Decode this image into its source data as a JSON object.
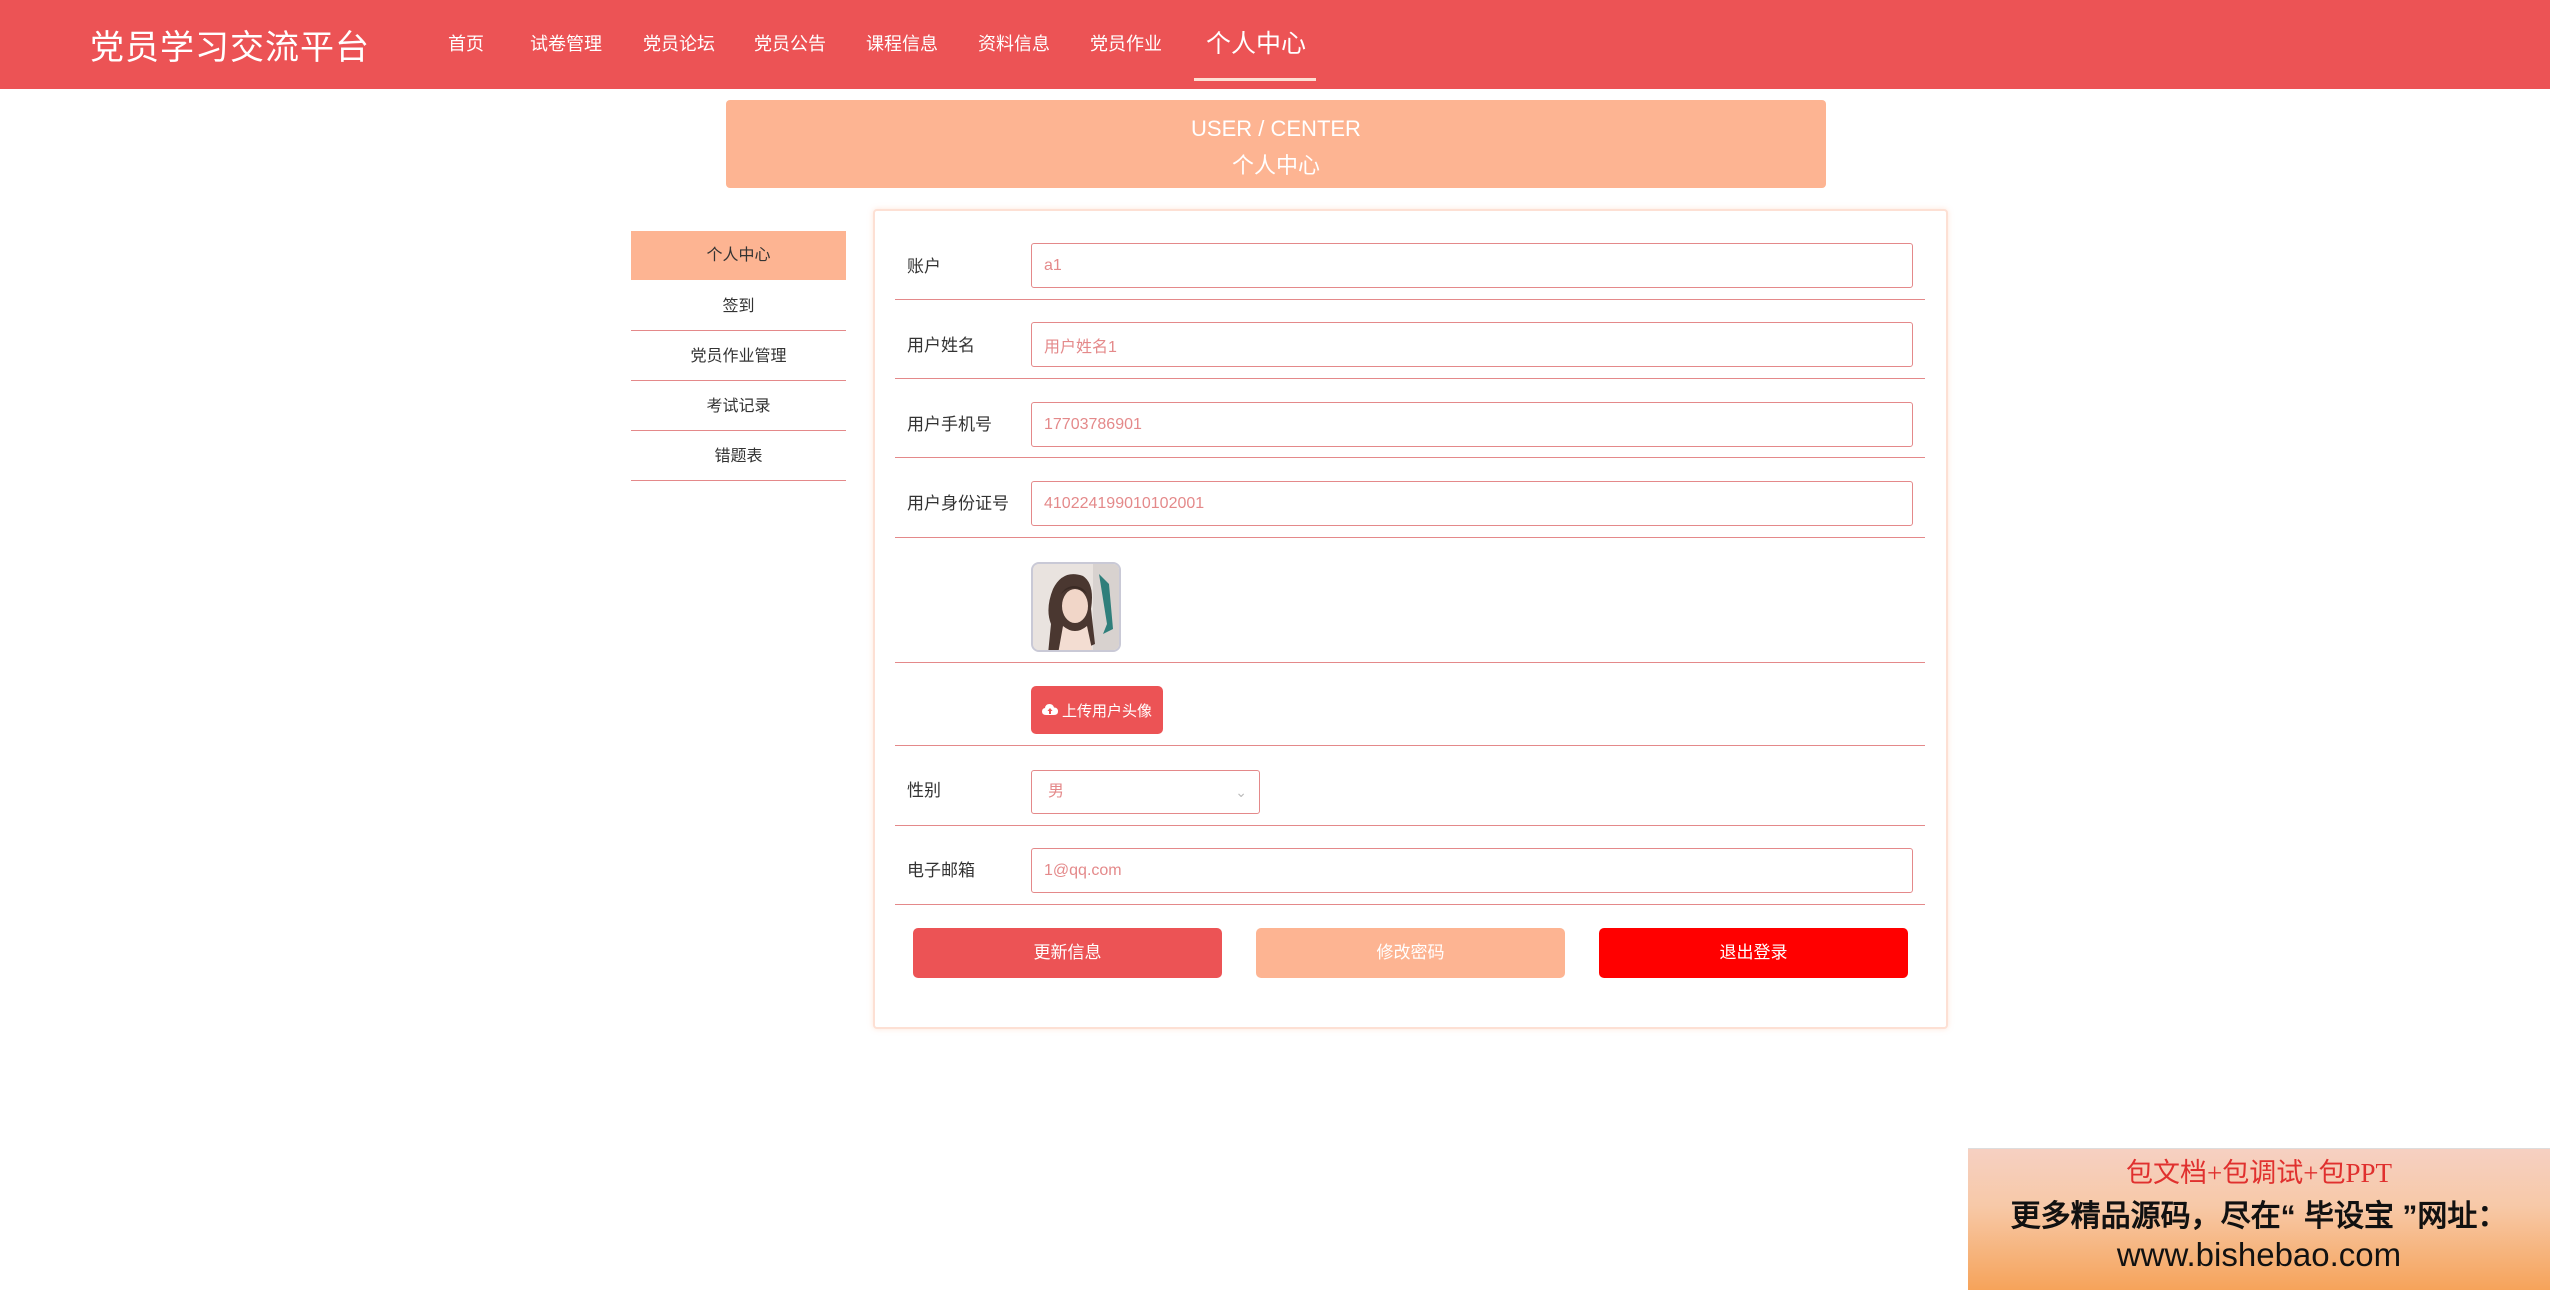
{
  "header": {
    "brand": "党员学习交流平台",
    "nav": [
      {
        "label": "首页"
      },
      {
        "label": "试卷管理"
      },
      {
        "label": "党员论坛"
      },
      {
        "label": "党员公告"
      },
      {
        "label": "课程信息"
      },
      {
        "label": "资料信息"
      },
      {
        "label": "党员作业"
      },
      {
        "label": "个人中心",
        "active": true
      }
    ]
  },
  "banner": {
    "en": "USER / CENTER",
    "cn": "个人中心"
  },
  "sidebar": {
    "items": [
      {
        "label": "个人中心",
        "active": true
      },
      {
        "label": "签到"
      },
      {
        "label": "党员作业管理"
      },
      {
        "label": "考试记录"
      },
      {
        "label": "错题表"
      }
    ]
  },
  "form": {
    "account": {
      "label": "账户",
      "value": "a1"
    },
    "name": {
      "label": "用户姓名",
      "value": "用户姓名1"
    },
    "phone": {
      "label": "用户手机号",
      "value": "17703786901"
    },
    "idcard": {
      "label": "用户身份证号",
      "value": "410224199010102001"
    },
    "upload_button": "上传用户头像",
    "gender": {
      "label": "性别",
      "value": "男"
    },
    "email": {
      "label": "电子邮箱",
      "value": "1@qq.com"
    }
  },
  "actions": {
    "update": "更新信息",
    "change_password": "修改密码",
    "logout": "退出登录"
  },
  "watermark": {
    "line1": "包文档+包调试+包PPT",
    "line2": "更多精品源码，尽在“ 毕设宝 ”网址：",
    "line3": "www.bishebao.com"
  },
  "colors": {
    "primary": "#ec5355",
    "accent": "#fdb492",
    "danger": "#ff0000",
    "border": "#e4898a"
  },
  "icons": {
    "upload": "cloud-upload-icon",
    "select": "chevron-down-icon"
  }
}
